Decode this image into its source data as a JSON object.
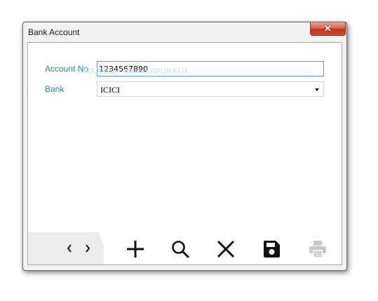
{
  "window": {
    "title": "Bank Account",
    "close_glyph": "✕"
  },
  "form": {
    "account_no_label": "Account No",
    "account_no_value": "1234567890",
    "bank_label": "Bank",
    "bank_value": "ICICI"
  },
  "watermark": "© RAJEESH MANALAPURATH",
  "toolbar": {
    "prev_icon": "chevron-left-icon",
    "next_icon": "chevron-right-icon",
    "buttons": [
      "add-icon",
      "search-icon",
      "delete-icon",
      "save-icon",
      "print-icon"
    ],
    "print_enabled": false
  },
  "colors": {
    "label": "#2b8a9a",
    "input_focus_border": "#5a9ec0",
    "close_button": "#c2311b",
    "icon": "#1a1a1a",
    "icon_disabled": "#c8c8c8"
  }
}
